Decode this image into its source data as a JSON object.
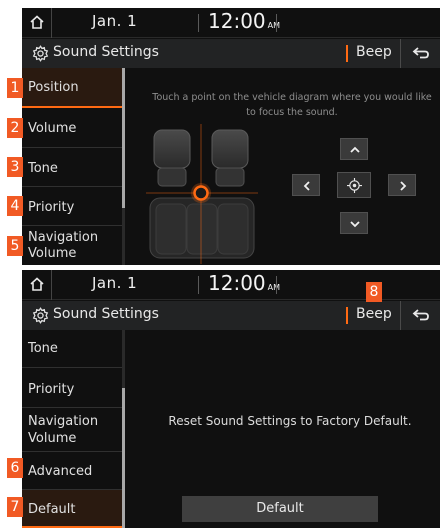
{
  "colors": {
    "accent": "#ff6a13",
    "badge": "#f15a24",
    "background": "#101010",
    "title_bar": "#222324"
  },
  "status": {
    "date": "Jan.  1",
    "time": "12:00",
    "ampm": "AM"
  },
  "header": {
    "title": "Sound Settings",
    "beep_label": "Beep",
    "home_icon": "home-icon",
    "back_icon": "back-icon",
    "settings_icon": "gear-icon"
  },
  "screen1": {
    "menu": [
      {
        "label": "Position",
        "badge": "1",
        "selected": true
      },
      {
        "label": "Volume",
        "badge": "2",
        "selected": false
      },
      {
        "label": "Tone",
        "badge": "3",
        "selected": false
      },
      {
        "label": "Priority",
        "badge": "4",
        "selected": false
      },
      {
        "label_line1": "Navigation",
        "label_line2": "Volume",
        "badge": "5",
        "selected": false
      }
    ],
    "instruction": "Touch a point on the vehicle diagram where you would like to focus the sound."
  },
  "screen2": {
    "menu": [
      {
        "label": "Tone"
      },
      {
        "label": "Priority"
      },
      {
        "label_line1": "Navigation",
        "label_line2": "Volume"
      },
      {
        "label": "Advanced",
        "badge": "6"
      },
      {
        "label": "Default",
        "badge": "7",
        "selected": true
      }
    ],
    "beep_badge": "8",
    "reset_message": "Reset Sound Settings to Factory Default.",
    "default_button": "Default"
  }
}
